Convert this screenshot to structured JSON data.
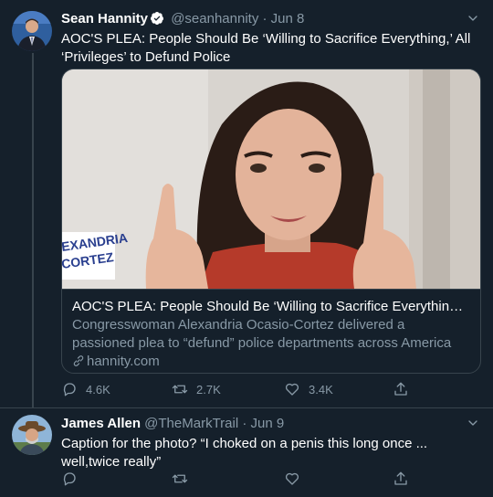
{
  "tweet1": {
    "name": "Sean Hannity",
    "handle": "@seanhannity",
    "separator": "·",
    "date": "Jun 8",
    "text": "AOC'S PLEA: People Should Be ‘Willing to Sacrifice Everything,’ All ‘Privileges’ to Defund Police",
    "card": {
      "image_caption_line1": "EXANDRIA",
      "image_caption_line2": "CORTEZ",
      "title": "AOC'S PLEA: People Should Be ‘Willing to Sacrifice Everything,’ All ‘P...",
      "description": "Congresswoman Alexandria Ocasio-Cortez delivered a passioned plea to “defund” police departments across America Sunday; asking peop...",
      "domain": "hannity.com"
    },
    "actions": {
      "replies": "4.6K",
      "retweets": "2.7K",
      "likes": "3.4K"
    }
  },
  "tweet2": {
    "name": "James Allen",
    "handle": "@TheMarkTrail",
    "separator": "·",
    "date": "Jun 9",
    "text": "Caption for the photo?  “I choked on a penis this long once ... well,twice really”"
  },
  "colors": {
    "background": "#15202b",
    "secondary_text": "#8899a6",
    "border": "#38444d",
    "verified": "#ffffff"
  },
  "icons": [
    "verified-badge-icon",
    "chevron-down-icon",
    "reply-icon",
    "retweet-icon",
    "like-icon",
    "share-icon",
    "link-icon"
  ]
}
